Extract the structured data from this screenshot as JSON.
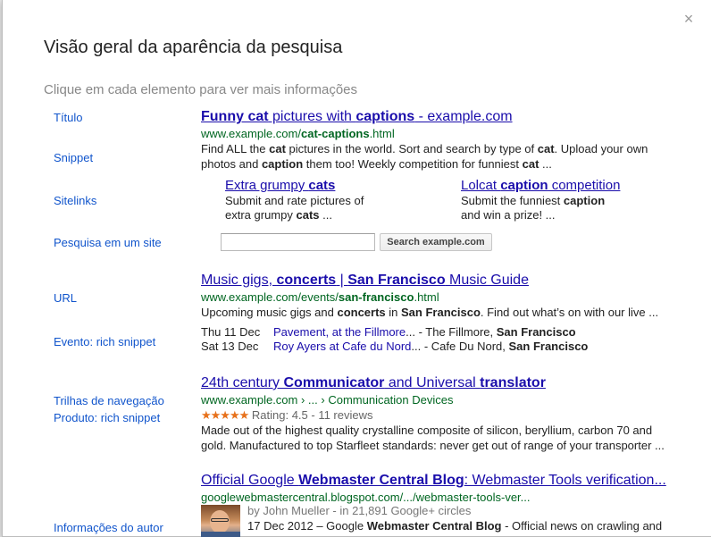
{
  "dialog": {
    "title": "Visão geral da aparência da pesquisa",
    "subtitle": "Clique em cada elemento para ver mais informações",
    "close": "×"
  },
  "labels": {
    "titulo": "Título",
    "snippet": "Snippet",
    "sitelinks": "Sitelinks",
    "site_search": "Pesquisa em um site",
    "url": "URL",
    "event": "Evento: rich snippet",
    "breadcrumbs": "Trilhas de navegação",
    "product": "Produto: rich snippet",
    "author": "Informações do autor"
  },
  "result1": {
    "title_parts": [
      "Funny cat",
      " pictures with ",
      "captions",
      " - example.com"
    ],
    "url_parts": [
      "www.example.com/",
      "cat-captions",
      ".html"
    ],
    "snippet_line1_parts": [
      "Find ALL the ",
      "cat",
      " pictures in the world. Sort and search by type of ",
      "cat",
      ". Upload your own"
    ],
    "snippet_line2_parts": [
      "photos and ",
      "caption",
      " them too! Weekly competition for funniest ",
      "cat",
      " ..."
    ],
    "sitelinks": [
      {
        "title_parts": [
          "Extra grumpy ",
          "cats"
        ],
        "desc_line1": "Submit and rate pictures of",
        "desc_line2_parts": [
          "extra grumpy ",
          "cats",
          " ..."
        ]
      },
      {
        "title_parts": [
          "Lolcat ",
          "caption",
          " competition"
        ],
        "desc_line1_parts": [
          "Submit the funniest ",
          "caption"
        ],
        "desc_line2": "and win a prize! ..."
      }
    ],
    "site_search": {
      "input_value": "",
      "button": "Search example.com"
    }
  },
  "result2": {
    "title_parts": [
      "Music gigs, ",
      "concerts",
      " | ",
      "San Francisco",
      " Music Guide"
    ],
    "url_parts": [
      "www.example.com/events/",
      "san-francisco",
      ".html"
    ],
    "snippet_parts": [
      "Upcoming music gigs and ",
      "concerts",
      " in ",
      "San Francisco",
      ". Find out what’s on with our live ..."
    ],
    "events": [
      {
        "date": "Thu 11 Dec",
        "link": "Pavement, at the Fillmore",
        "rest_pre": " ... - The Fillmore, ",
        "rest_bold": "San Francisco"
      },
      {
        "date": "Sat 13 Dec",
        "link": "Roy Ayers at Cafe du Nord",
        "rest_pre": " ... - Cafe Du Nord, ",
        "rest_bold": "San Francisco"
      }
    ]
  },
  "result3": {
    "title_parts": [
      "24th century ",
      "Communicator",
      " and Universal ",
      "translator"
    ],
    "breadcrumb_parts": [
      "www.example.com",
      " › ... › ",
      "Communication Devices"
    ],
    "stars": "★★★★★",
    "rating": " Rating: 4.5 - 11 reviews",
    "snippet_line1": "Made out of the highest quality crystalline composite of silicon, beryllium, carbon 70 and",
    "snippet_line2": "gold. Manufactured to top Starfleet standards: never get out of range of your transporter ..."
  },
  "result4": {
    "title_parts": [
      "Official Google ",
      "Webmaster Central Blog",
      ": Webmaster Tools verification..."
    ],
    "url": "googlewebmastercentral.blogspot.com/.../webmaster-tools-ver...",
    "author_line": "by John Mueller - in 21,891 Google+ circles",
    "author_prefix": "by ",
    "author_name": "John Mueller",
    "author_circles": " - in 21,891 Google+ circles",
    "snippet_parts": [
      "17 Dec 2012 – Google ",
      "Webmaster Central Blog",
      " - Official news on crawling and"
    ]
  },
  "colors": {
    "link": "#1a0dab",
    "label_link": "#1155cc",
    "url_green": "#006621",
    "star": "#e7711b"
  }
}
